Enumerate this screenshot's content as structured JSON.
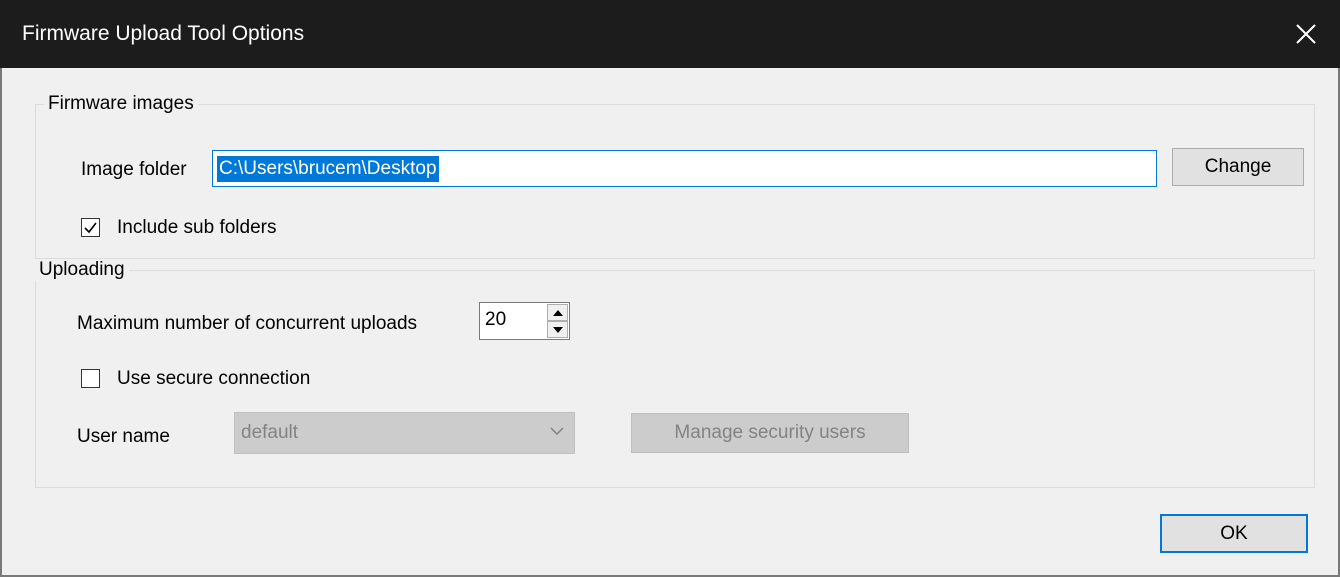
{
  "window": {
    "title": "Firmware Upload Tool Options"
  },
  "firmware_images": {
    "legend": "Firmware images",
    "image_folder_label": "Image folder",
    "image_folder_value": "C:\\Users\\brucem\\Desktop",
    "change_label": "Change",
    "include_sub_folders_label": "Include sub folders",
    "include_sub_folders_checked": true
  },
  "uploading": {
    "legend": "Uploading",
    "max_uploads_label": "Maximum number of concurrent uploads",
    "max_uploads_value": "20",
    "secure_connection_label": "Use secure connection",
    "secure_connection_checked": false,
    "user_name_label": "User name",
    "user_name_value": "default",
    "manage_users_label": "Manage security users"
  },
  "footer": {
    "ok_label": "OK"
  },
  "colors": {
    "accent": "#0078d7",
    "titlebar": "#1c1c1c",
    "disabled_text": "#838383"
  }
}
